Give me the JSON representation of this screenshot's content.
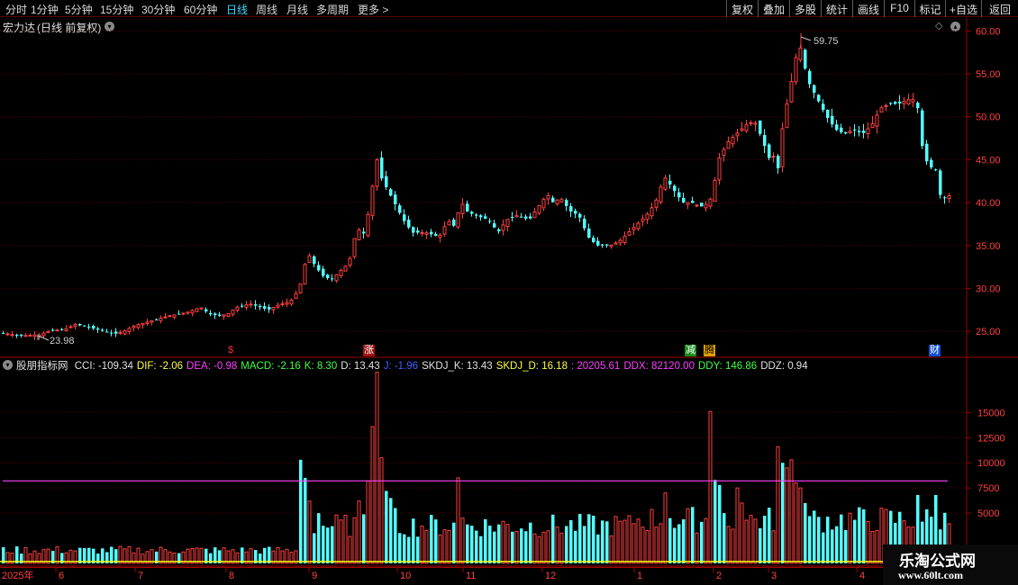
{
  "toolbar": {
    "periods": [
      "分时",
      "1分钟",
      "5分钟",
      "15分钟",
      "30分钟",
      "60分钟",
      "日线",
      "周线",
      "月线",
      "多周期",
      "更多"
    ],
    "active_period": "日线",
    "more_arrow": ">",
    "buttons": [
      "复权",
      "叠加",
      "多股",
      "统计",
      "画线",
      "F10",
      "标记",
      "+自选",
      "返回"
    ]
  },
  "stock": {
    "name": "宏力达",
    "mode": "(日线 前复权)",
    "high_label": "59.75",
    "low_label": "23.98"
  },
  "colors": {
    "up": "#ff4040",
    "down": "#54ffff",
    "grid": "#5a0000",
    "axis": "#a00000",
    "ref_line": "#ff40ff"
  },
  "markers": [
    {
      "text": "$",
      "color": "#ff3030"
    },
    {
      "text": "涨",
      "color": "#ffffff",
      "bg": "#a01010"
    },
    {
      "text": "减",
      "color": "#ffffff",
      "bg": "#1a8a1a"
    },
    {
      "text": "腾",
      "color": "#000000",
      "bg": "#e0a000"
    },
    {
      "text": "财",
      "color": "#ffffff",
      "bg": "#1050d0"
    }
  ],
  "indicator": {
    "name": "股朋指标网",
    "values": [
      {
        "text": "CCI: -109.34",
        "color": "#e0e0e0"
      },
      {
        "text": "DIF: -2.06",
        "color": "#ffff40"
      },
      {
        "text": "DEA: -0.98",
        "color": "#ff40ff"
      },
      {
        "text": "MACD: -2.16",
        "color": "#40ff40"
      },
      {
        "text": "K: 8.30",
        "color": "#40ff40"
      },
      {
        "text": "D: 13.43",
        "color": "#e0e0e0"
      },
      {
        "text": "J: -1.96",
        "color": "#4060ff"
      },
      {
        "text": "SKDJ_K: 13.43",
        "color": "#e0e0e0"
      },
      {
        "text": "SKDJ_D: 16.18",
        "color": "#ffff40"
      },
      {
        "text": ": 20205.61",
        "color": "#ff40ff"
      },
      {
        "text": "DDX: 82120.00",
        "color": "#ff40ff"
      },
      {
        "text": "DDY: 146.86",
        "color": "#40ff40"
      },
      {
        "text": "DDZ: 0.94",
        "color": "#e0e0e0"
      }
    ]
  },
  "chart_data": [
    {
      "type": "candlestick",
      "y_ticks": [
        "60.00",
        "55.00",
        "50.00",
        "45.00",
        "40.00",
        "35.00",
        "30.00",
        "25.00"
      ],
      "ylim": [
        22.5,
        61.5
      ],
      "high": 59.75,
      "low": 23.98,
      "close_path": [
        [
          0,
          24.8
        ],
        [
          22,
          24.5
        ],
        [
          42,
          24.6
        ],
        [
          52,
          25.0
        ],
        [
          72,
          25.3
        ],
        [
          82,
          25.8
        ],
        [
          96,
          25.5
        ],
        [
          114,
          25.0
        ],
        [
          126,
          24.7
        ],
        [
          136,
          25.0
        ],
        [
          146,
          25.6
        ],
        [
          166,
          26.2
        ],
        [
          186,
          26.8
        ],
        [
          206,
          27.2
        ],
        [
          221,
          27.8
        ],
        [
          231,
          27.0
        ],
        [
          241,
          26.8
        ],
        [
          251,
          27.0
        ],
        [
          261,
          27.8
        ],
        [
          276,
          28.2
        ],
        [
          296,
          27.5
        ],
        [
          306,
          28.0
        ],
        [
          321,
          28.5
        ],
        [
          331,
          30.0
        ],
        [
          336,
          32.5
        ],
        [
          341,
          34.0
        ],
        [
          346,
          33.0
        ],
        [
          356,
          31.5
        ],
        [
          366,
          31.0
        ],
        [
          376,
          32.0
        ],
        [
          386,
          33.0
        ],
        [
          391,
          35.5
        ],
        [
          396,
          37.0
        ],
        [
          401,
          36.0
        ],
        [
          406,
          38.0
        ],
        [
          411,
          41.0
        ],
        [
          416,
          45.5
        ],
        [
          421,
          43.0
        ],
        [
          426,
          42.0
        ],
        [
          436,
          40.0
        ],
        [
          446,
          38.0
        ],
        [
          456,
          36.5
        ],
        [
          471,
          36.5
        ],
        [
          486,
          36.0
        ],
        [
          496,
          38.0
        ],
        [
          501,
          37.0
        ],
        [
          511,
          40.0
        ],
        [
          516,
          39.0
        ],
        [
          526,
          38.5
        ],
        [
          541,
          38.0
        ],
        [
          551,
          36.5
        ],
        [
          561,
          38.0
        ],
        [
          571,
          38.5
        ],
        [
          586,
          38.0
        ],
        [
          596,
          39.5
        ],
        [
          606,
          41.0
        ],
        [
          611,
          40.0
        ],
        [
          621,
          40.5
        ],
        [
          631,
          39.0
        ],
        [
          641,
          38.5
        ],
        [
          651,
          36.0
        ],
        [
          661,
          35.0
        ],
        [
          676,
          35.0
        ],
        [
          686,
          35.5
        ],
        [
          696,
          36.5
        ],
        [
          706,
          37.5
        ],
        [
          716,
          38.5
        ],
        [
          726,
          40.0
        ],
        [
          736,
          43.0
        ],
        [
          746,
          41.5
        ],
        [
          756,
          40.0
        ],
        [
          766,
          40.0
        ],
        [
          776,
          39.5
        ],
        [
          786,
          40.0
        ],
        [
          791,
          42.0
        ],
        [
          796,
          45.0
        ],
        [
          806,
          47.0
        ],
        [
          816,
          48.0
        ],
        [
          826,
          49.0
        ],
        [
          836,
          49.5
        ],
        [
          846,
          47.0
        ],
        [
          851,
          45.0
        ],
        [
          856,
          46.0
        ],
        [
          861,
          43.0
        ],
        [
          866,
          48.0
        ],
        [
          871,
          51.0
        ],
        [
          876,
          53.5
        ],
        [
          881,
          56.5
        ],
        [
          886,
          58.5
        ],
        [
          891,
          56.0
        ],
        [
          896,
          54.0
        ],
        [
          906,
          52.0
        ],
        [
          916,
          50.0
        ],
        [
          926,
          48.5
        ],
        [
          936,
          48.0
        ],
        [
          946,
          48.5
        ],
        [
          956,
          48.0
        ],
        [
          966,
          49.0
        ],
        [
          976,
          51.0
        ],
        [
          986,
          51.5
        ],
        [
          996,
          51.5
        ],
        [
          1006,
          52.0
        ],
        [
          1016,
          52.0
        ],
        [
          1021,
          47.0
        ],
        [
          1026,
          45.0
        ],
        [
          1031,
          44.0
        ],
        [
          1036,
          44.5
        ],
        [
          1041,
          41.0
        ],
        [
          1046,
          40.5
        ],
        [
          1051,
          40.8
        ]
      ]
    },
    {
      "type": "bar",
      "y_ticks": [
        "15000",
        "12500",
        "10000",
        "7500",
        "5000"
      ],
      "ylim": [
        0,
        19500
      ],
      "reference_level": 8200,
      "spikes": [
        [
          331,
          10300,
          "down"
        ],
        [
          336,
          8500,
          "down"
        ],
        [
          341,
          6200,
          "up"
        ],
        [
          351,
          5000,
          "down"
        ],
        [
          396,
          6200,
          "up"
        ],
        [
          406,
          8200,
          "up"
        ],
        [
          411,
          13600,
          "up"
        ],
        [
          416,
          19000,
          "up"
        ],
        [
          421,
          10500,
          "up"
        ],
        [
          426,
          7200,
          "down"
        ],
        [
          431,
          6500,
          "down"
        ],
        [
          436,
          5500,
          "down"
        ],
        [
          506,
          8500,
          "up"
        ],
        [
          511,
          4500,
          "up"
        ],
        [
          736,
          7000,
          "up"
        ],
        [
          741,
          4500,
          "down"
        ],
        [
          786,
          15100,
          "up"
        ],
        [
          791,
          8300,
          "down"
        ],
        [
          796,
          7800,
          "down"
        ],
        [
          801,
          5000,
          "down"
        ],
        [
          816,
          7500,
          "up"
        ],
        [
          821,
          6000,
          "up"
        ],
        [
          861,
          11600,
          "up"
        ],
        [
          866,
          10000,
          "down"
        ],
        [
          871,
          9500,
          "up"
        ],
        [
          876,
          10300,
          "up"
        ],
        [
          881,
          8000,
          "up"
        ],
        [
          886,
          7500,
          "up"
        ],
        [
          891,
          6000,
          "down"
        ],
        [
          1016,
          6800,
          "down"
        ],
        [
          1036,
          6800,
          "down"
        ]
      ],
      "baseline_level": 2400
    }
  ],
  "x_axis": {
    "year_label": "2025年",
    "months": [
      "6",
      "7",
      "8",
      "9",
      "10",
      "11",
      "12",
      "1",
      "2",
      "3",
      "4"
    ]
  },
  "watermark": {
    "title": "乐淘公式网",
    "url": "www.60lt.com"
  }
}
